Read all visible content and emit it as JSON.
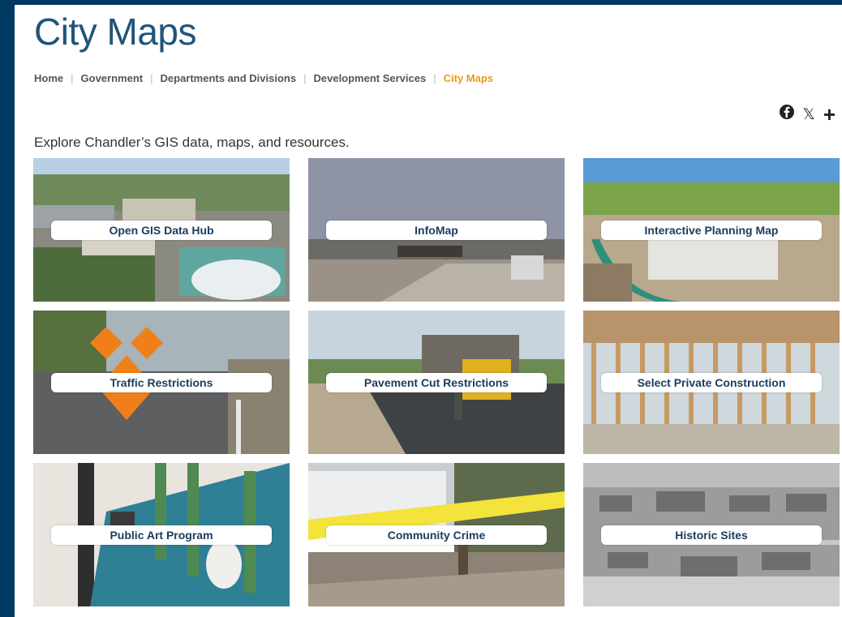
{
  "page_title": "City Maps",
  "breadcrumb": {
    "items": [
      "Home",
      "Government",
      "Departments and Divisions",
      "Development Services"
    ],
    "current": "City Maps",
    "separator": "|"
  },
  "share": {
    "icons": [
      "facebook-icon",
      "x-icon",
      "plus-icon"
    ],
    "x_glyph": "𝕏",
    "plus_glyph": "+"
  },
  "intro": "Explore Chandler’s GIS data, maps, and resources.",
  "tiles": [
    {
      "label": "Open GIS Data Hub",
      "image": "aerial-city-photo"
    },
    {
      "label": "InfoMap",
      "image": "plaza-walkway-photo"
    },
    {
      "label": "Interactive Planning Map",
      "image": "aerial-apartments-photo"
    },
    {
      "label": "Traffic Restrictions",
      "image": "road-work-sign-photo"
    },
    {
      "label": "Pavement Cut Restrictions",
      "image": "paving-crew-photo"
    },
    {
      "label": "Select Private Construction",
      "image": "wood-framing-photo"
    },
    {
      "label": "Public Art Program",
      "image": "cactus-mural-photo"
    },
    {
      "label": "Community Crime",
      "image": "police-tape-photo"
    },
    {
      "label": "Historic Sites",
      "image": "historic-aerial-photo"
    }
  ],
  "colors": {
    "frame": "#003a63",
    "title": "#1f5579",
    "breadcrumb_current": "#e79a1a",
    "tile_label": "#1a3c5d"
  }
}
